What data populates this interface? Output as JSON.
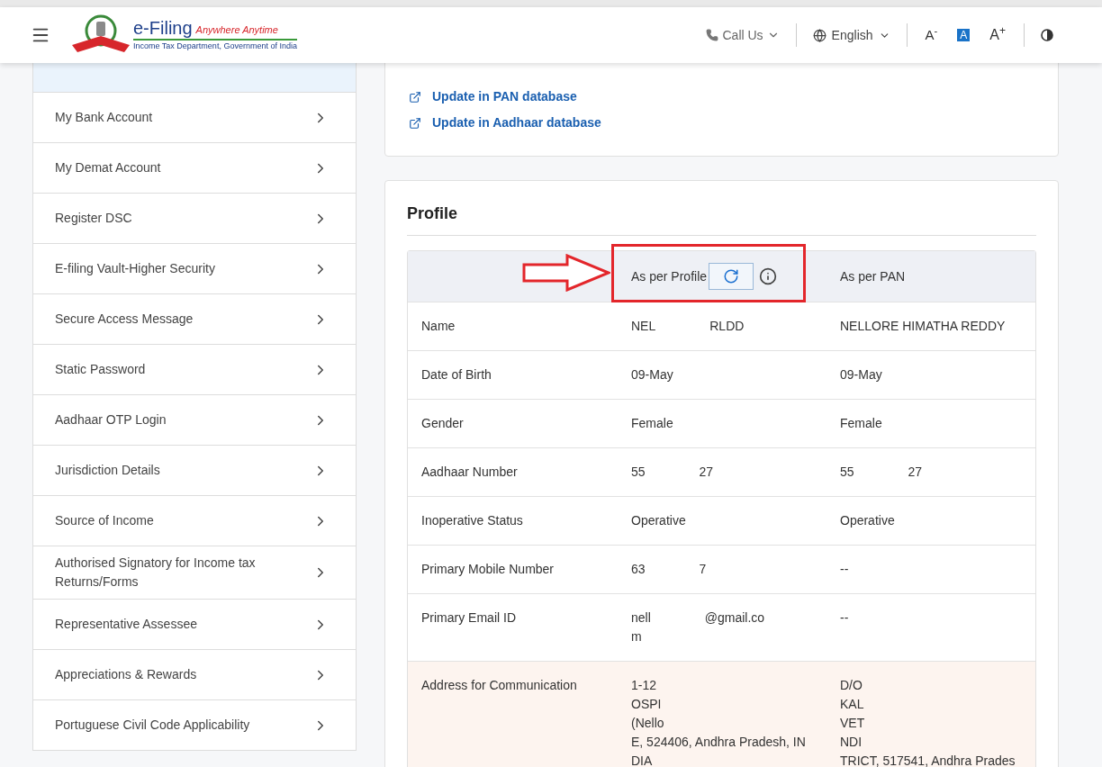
{
  "header": {
    "title": "e-Filing",
    "tagline": "Anywhere Anytime",
    "subtitle": "Income Tax Department, Government of India",
    "call_us": "Call Us",
    "language": "English",
    "font_buttons": [
      {
        "label": "A$^{-}$",
        "kind": "decrease",
        "selected": false
      },
      {
        "label": "A",
        "kind": "default",
        "selected": true
      },
      {
        "label": "A$^{+}$",
        "kind": "increase",
        "selected": false
      }
    ]
  },
  "sidebar": {
    "items": [
      {
        "label": "My Bank Account"
      },
      {
        "label": "My Demat Account"
      },
      {
        "label": "Register DSC"
      },
      {
        "label": "E-filing Vault-Higher Security"
      },
      {
        "label": "Secure Access Message"
      },
      {
        "label": "Static Password"
      },
      {
        "label": "Aadhaar OTP Login"
      },
      {
        "label": "Jurisdiction Details"
      },
      {
        "label": "Source of Income"
      },
      {
        "label": "Authorised Signatory for Income tax Returns/Forms"
      },
      {
        "label": "Representative Assessee"
      },
      {
        "label": "Appreciations & Rewards"
      },
      {
        "label": "Portuguese Civil Code Applicability"
      }
    ]
  },
  "links": [
    "Update in PAN database",
    "Update in Aadhaar database"
  ],
  "profile": {
    "title": "Profile",
    "column_2": "As per Profile",
    "column_3": "As per PAN",
    "rows": [
      {
        "label": "Name",
        "highlighted": false,
        "profile": [
          [
            "NEL",
            "RLDD"
          ]
        ],
        "pan": [
          [
            "NELLORE HIMATHA REDDY"
          ]
        ]
      },
      {
        "label": "Date of Birth",
        "highlighted": false,
        "profile": [
          [
            "09-May"
          ]
        ],
        "pan": [
          [
            "09-May"
          ]
        ]
      },
      {
        "label": "Gender",
        "highlighted": false,
        "profile": [
          [
            "Female"
          ]
        ],
        "pan": [
          [
            "Female"
          ]
        ]
      },
      {
        "label": "Aadhaar Number",
        "highlighted": false,
        "profile": [
          [
            "55",
            "27"
          ]
        ],
        "pan": [
          [
            "55",
            "27"
          ]
        ]
      },
      {
        "label": "Inoperative Status",
        "highlighted": false,
        "profile": [
          [
            "Operative"
          ]
        ],
        "pan": [
          [
            "Operative"
          ]
        ]
      },
      {
        "label": "Primary Mobile Number",
        "highlighted": false,
        "profile": [
          [
            "63",
            "7"
          ]
        ],
        "pan": [
          [
            "--"
          ]
        ]
      },
      {
        "label": "Primary Email ID",
        "highlighted": false,
        "profile": [
          [
            "nell",
            "@gmail.co"
          ],
          [
            "m"
          ]
        ],
        "pan": [
          [
            "--"
          ]
        ]
      },
      {
        "label": "Address for Communication",
        "highlighted": true,
        "profile": [
          [
            "1-12"
          ],
          [
            "OSPI"
          ],
          [
            "(Nello"
          ],
          [
            "E, 524406, Andhra Pradesh, IN"
          ],
          [
            "DIA"
          ]
        ],
        "pan": [
          [
            "D/O"
          ],
          [
            "KAL"
          ],
          [
            "VET"
          ],
          [
            "NDI"
          ],
          [
            "TRICT, 517541, Andhra Prades"
          ]
        ]
      }
    ]
  }
}
